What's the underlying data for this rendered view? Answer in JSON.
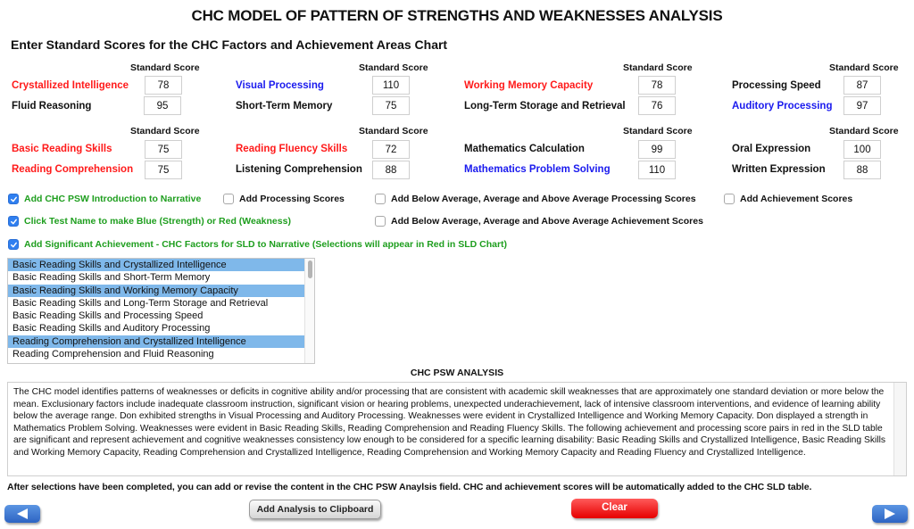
{
  "title": "CHC MODEL OF PATTERN OF STRENGTHS AND WEAKNESSES ANALYSIS",
  "subtitle": "Enter Standard Scores for the CHC Factors and Achievement Areas Chart",
  "standard_score_header": "Standard Score",
  "colors": {
    "weakness": "#ff1a1a",
    "strength": "#1a1aee",
    "neutral": "#111111",
    "option_text": "#1e9e1e",
    "selected_row": "#7fb8ea"
  },
  "cognitive_factors": [
    {
      "label": "Crystallized Intelligence",
      "score": "78",
      "status": "weakness"
    },
    {
      "label": "Fluid Reasoning",
      "score": "95",
      "status": "neutral"
    },
    {
      "label": "Visual Processing",
      "score": "110",
      "status": "strength"
    },
    {
      "label": "Short-Term Memory",
      "score": "75",
      "status": "neutral"
    },
    {
      "label": "Working Memory Capacity",
      "score": "78",
      "status": "weakness"
    },
    {
      "label": "Long-Term Storage and Retrieval",
      "score": "76",
      "status": "neutral"
    },
    {
      "label": "Processing Speed",
      "score": "87",
      "status": "neutral"
    },
    {
      "label": "Auditory Processing",
      "score": "97",
      "status": "strength"
    }
  ],
  "achievement_areas": [
    {
      "label": "Basic Reading Skills",
      "score": "75",
      "status": "weakness"
    },
    {
      "label": "Reading Comprehension",
      "score": "75",
      "status": "weakness"
    },
    {
      "label": "Reading Fluency Skills",
      "score": "72",
      "status": "weakness"
    },
    {
      "label": "Listening Comprehension",
      "score": "88",
      "status": "neutral"
    },
    {
      "label": "Mathematics Calculation",
      "score": "99",
      "status": "neutral"
    },
    {
      "label": "Mathematics Problem Solving",
      "score": "110",
      "status": "strength"
    },
    {
      "label": "Oral Expression",
      "score": "100",
      "status": "neutral"
    },
    {
      "label": "Written Expression",
      "score": "88",
      "status": "neutral"
    }
  ],
  "options": [
    {
      "label": "Add CHC PSW Introduction to Narrative",
      "checked": true
    },
    {
      "label": "Add Processing Scores",
      "checked": false
    },
    {
      "label": "Add Below Average, Average and Above Average Processing Scores",
      "checked": false
    },
    {
      "label": "Add Achievement Scores",
      "checked": false
    },
    {
      "label": "Click Test Name to make Blue (Strength) or Red (Weakness)",
      "checked": true
    },
    {
      "label": "Add Below Average, Average and Above Average Achievement Scores",
      "checked": false
    },
    {
      "label": "Add Significant Achievement - CHC Factors for SLD to Narrative (Selections will appear in Red in SLD Chart)",
      "checked": true
    }
  ],
  "sld_pairs": [
    {
      "label": "Basic Reading Skills and Crystallized Intelligence",
      "selected": true
    },
    {
      "label": "Basic Reading Skills and Short-Term Memory",
      "selected": false
    },
    {
      "label": "Basic Reading Skills and Working Memory Capacity",
      "selected": true
    },
    {
      "label": "Basic Reading Skills and Long-Term Storage and Retrieval",
      "selected": false
    },
    {
      "label": "Basic Reading Skills and Processing Speed",
      "selected": false
    },
    {
      "label": "Basic Reading Skills and Auditory Processing",
      "selected": false
    },
    {
      "label": "Reading Comprehension and Crystallized Intelligence",
      "selected": true
    },
    {
      "label": "Reading Comprehension and Fluid Reasoning",
      "selected": false
    }
  ],
  "analysis": {
    "label": "CHC PSW ANALYSIS",
    "text": "The CHC model identifies patterns of weaknesses or deficits in cognitive ability and/or processing that are consistent with academic skill weaknesses that are approximately one standard deviation or more below the mean. Exclusionary factors include inadequate classroom instruction, significant vision or hearing problems, unexpected underachievement, lack of intensive classroom interventions, and evidence of learning ability below the average range. Don exhibited strengths in Visual Processing and Auditory Processing. Weaknesses were evident in Crystallized Intelligence and Working Memory Capacity. Don displayed a strength in Mathematics Problem Solving. Weaknesses were evident in Basic Reading Skills, Reading Comprehension and Reading Fluency Skills. The following achievement and processing score pairs in red in the SLD table are significant and represent achievement and cognitive weaknesses consistency low enough to be considered for a specific learning disability:   Basic Reading Skills and Crystallized Intelligence, Basic Reading Skills and Working Memory Capacity, Reading Comprehension and Crystallized Intelligence, Reading Comprehension and Working Memory Capacity and Reading Fluency and Crystallized Intelligence."
  },
  "footer_note": "After selections have been completed, you can add or revise the content in the CHC PSW Anaylsis field.  CHC and achievement scores will be automatically added to the CHC SLD table.",
  "buttons": {
    "prev_icon": "left-arrow-icon",
    "next_icon": "right-arrow-icon",
    "clipboard": "Add Analysis to Clipboard",
    "clear": "Clear"
  }
}
